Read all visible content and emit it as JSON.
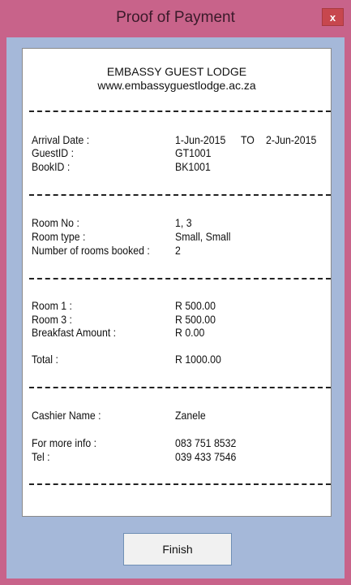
{
  "window": {
    "title": "Proof of Payment",
    "close_label": "x"
  },
  "receipt": {
    "header": {
      "name": "EMBASSY GUEST LODGE",
      "website": "www.embassyguestlodge.ac.za"
    },
    "booking": {
      "arrival_label": "Arrival Date :",
      "arrival_from": "1-Jun-2015",
      "arrival_to_label": "TO",
      "arrival_to": "2-Jun-2015",
      "guest_label": "GuestID :",
      "guest_value": "GT1001",
      "book_label": "BookID :",
      "book_value": "BK1001"
    },
    "rooms": {
      "room_no_label": "Room No :",
      "room_no_value": "1, 3",
      "room_type_label": "Room type  :",
      "room_type_value": "Small, Small",
      "count_label": "Number of rooms booked :",
      "count_value": "2"
    },
    "charges": {
      "room1_label": "Room 1 :",
      "room1_value": "R 500.00",
      "room3_label": "Room 3 :",
      "room3_value": "R 500.00",
      "breakfast_label": "Breakfast Amount :",
      "breakfast_value": "R 0.00",
      "total_label": "Total  :",
      "total_value": "R 1000.00"
    },
    "contact": {
      "cashier_label": "Cashier Name :",
      "cashier_value": "Zanele",
      "info_label": "For more info :",
      "info_value": "083 751 8532",
      "tel_label": "Tel :",
      "tel_value": "039 433 7546"
    }
  },
  "actions": {
    "finish_label": "Finish"
  },
  "colors": {
    "frame": "#c8638a",
    "client": "#a5b8d9",
    "close": "#c7474e"
  }
}
